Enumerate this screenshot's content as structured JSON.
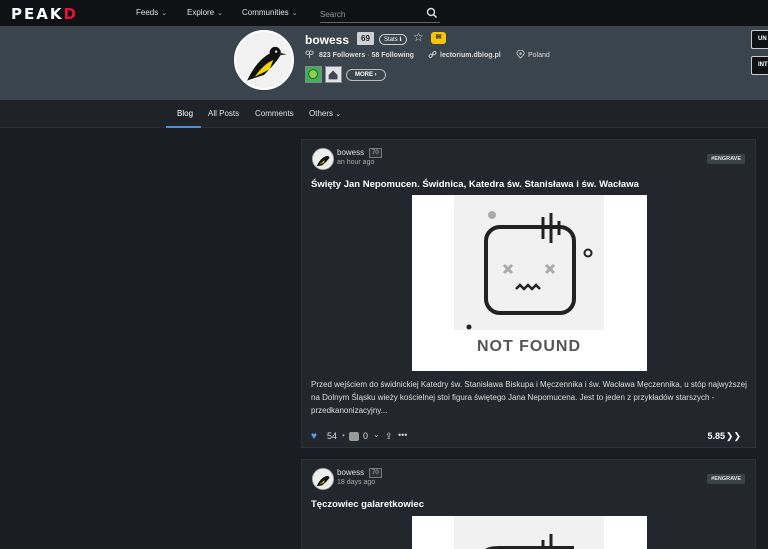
{
  "nav": {
    "logo_main": "PEAK",
    "logo_accent": "D",
    "items": [
      {
        "label": "Feeds"
      },
      {
        "label": "Explore"
      },
      {
        "label": "Communities"
      }
    ],
    "search_placeholder": "Search"
  },
  "profile": {
    "username": "bowess",
    "reputation": "69",
    "stats_label": "Stats",
    "followers": "823 Followers",
    "following": "58 Following",
    "separator": "·",
    "website": "lectorium.dblog.pl",
    "location": "Poland",
    "more_label": "MORE",
    "right_buttons": [
      "UN",
      "INTER"
    ]
  },
  "tabs": [
    {
      "label": "Blog",
      "active": true
    },
    {
      "label": "All Posts"
    },
    {
      "label": "Comments"
    },
    {
      "label": "Others"
    }
  ],
  "posts": [
    {
      "author": "bowess",
      "reputation": "70",
      "time": "an hour ago",
      "tag": "#ENGRAVE",
      "title": "Święty Jan Nepomucen. Świdnica, Katedra św. Stanisława i św. Wacława",
      "image_caption": "NOT FOUND",
      "excerpt": "Przed wejściem do świdnickiej Katedry św. Stanisława Biskupa i Męczennika i św. Wacława Męczennika, u stóp najwyższej na Dolnym Śląsku wieży kościelnej stoi figura świętego Jana Nepomucena. Jest to jeden z przykładów starszych - przedkanonizacyjny...",
      "votes": "54",
      "comments": "0",
      "payout": "5.85"
    },
    {
      "author": "bowess",
      "reputation": "70",
      "time": "18 days ago",
      "tag": "#ENGRAVE",
      "title": "Tęczowiec galaretkowiec"
    }
  ],
  "colors": {
    "accent": "#e31337",
    "link_blue": "#4a8fd8",
    "header_bg": "#39444d"
  }
}
